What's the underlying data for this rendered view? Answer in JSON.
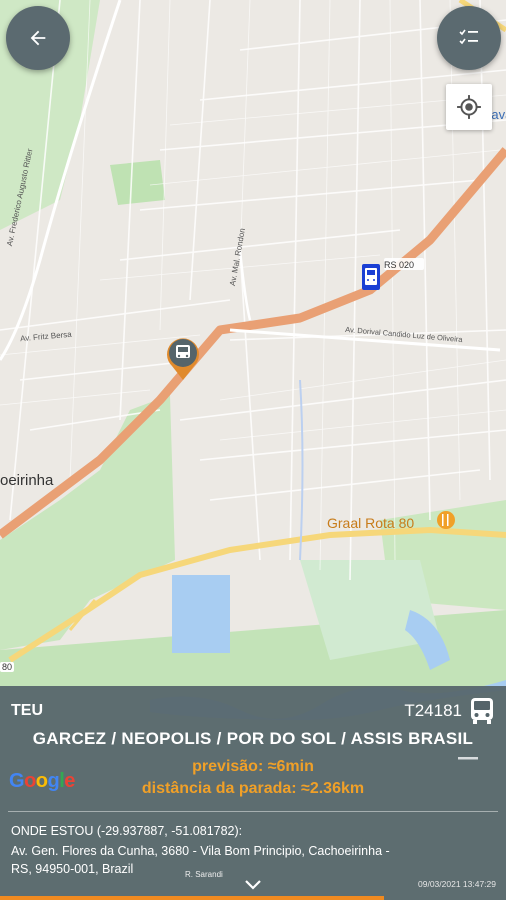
{
  "map": {
    "labels": {
      "city": "oeirinha",
      "rs020": "RS 020",
      "poi": "Graal Rota 80",
      "av_fritz": "Av. Fritz Bersa",
      "av_dorival": "Av. Dorival Candido Luz de Oliveira",
      "av_frederico": "Av. Frederico Augusto Ritter",
      "av_mal": "Av. Mal. Rondon",
      "top_right": "Hava",
      "bottom_left": "80",
      "bottom_small": "R. Sarandi"
    },
    "google_logo": {
      "letters": [
        "G",
        "o",
        "o",
        "g",
        "l",
        "e"
      ],
      "colors": [
        "#4285F4",
        "#EA4335",
        "#FBBC05",
        "#4285F4",
        "#34A853",
        "#EA4335"
      ]
    }
  },
  "buttons": {
    "back_icon": "arrow-left",
    "menu_icon": "checklist",
    "locate_icon": "crosshair"
  },
  "panel": {
    "line_code": "TEU",
    "vehicle_id": "T24181",
    "route": "GARCEZ / NEOPOLIS  / POR DO SOL / ASSIS BRASIL",
    "eta": "previsão: ≈6min",
    "distance": "distância da parada: ≈2.36km",
    "location_label": "ONDE ESTOU (-29.937887, -51.081782):",
    "location_address": "Av. Gen. Flores da Cunha, 3680 - Vila Bom Principio, Cachoeirinha - RS, 94950-001, Brazil",
    "timestamp": "09/03/2021 13:47:29"
  },
  "colors": {
    "accent": "#f0a028",
    "panel_bg": "#55646a",
    "bus_marker": "#e08a2c",
    "stop_marker": "#1a3fd4"
  }
}
